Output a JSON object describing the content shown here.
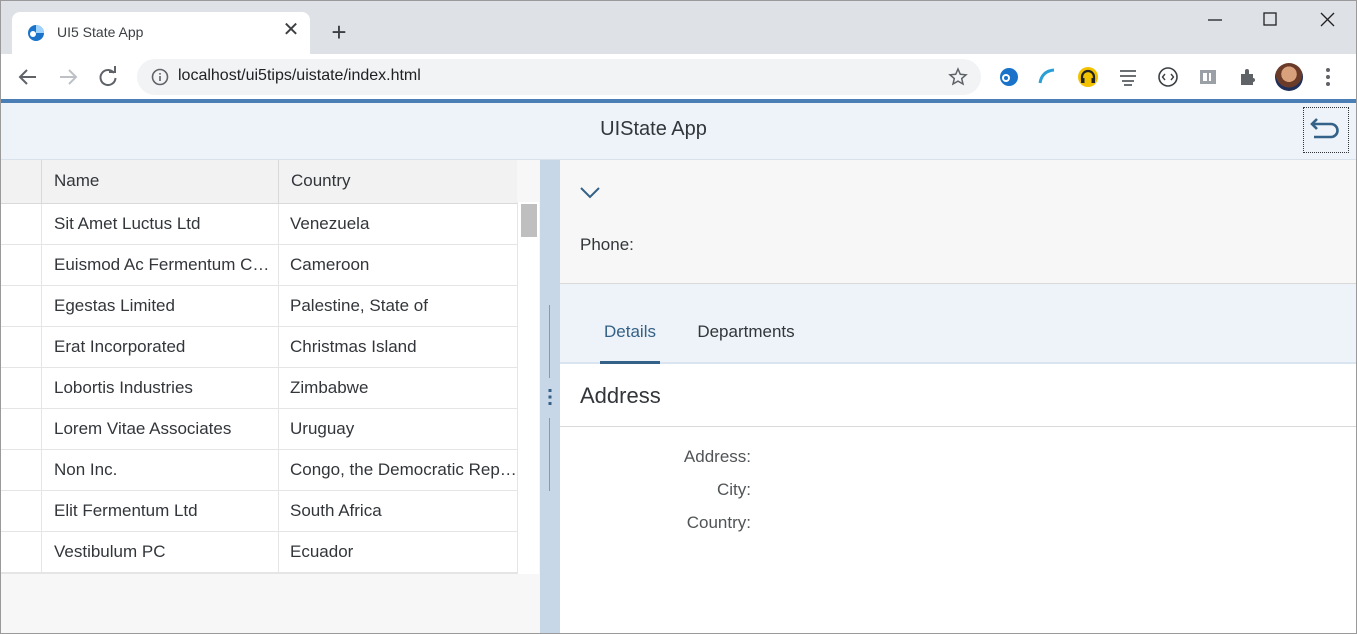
{
  "browser": {
    "tab_title": "UI5 State App",
    "tab_close_glyph": "✕",
    "new_tab_glyph": "+",
    "url_host": "localhost",
    "url_path": "/ui5tips/uistate/index.html",
    "icons": [
      "back-arrow-icon",
      "forward-arrow-icon",
      "reload-icon",
      "info-icon",
      "star-icon",
      "extensions-icon",
      "kebab-menu-icon"
    ]
  },
  "app": {
    "title": "UIState App",
    "accent_color": "#4a7eb5",
    "shell_color": "#edf3f8"
  },
  "table": {
    "columns": [
      "Name",
      "Country"
    ],
    "rows": [
      {
        "name": "Sit Amet Luctus Ltd",
        "country": "Venezuela"
      },
      {
        "name": "Euismod Ac Fermentum Corp.",
        "country": "Cameroon"
      },
      {
        "name": "Egestas Limited",
        "country": "Palestine, State of"
      },
      {
        "name": "Erat Incorporated",
        "country": "Christmas Island"
      },
      {
        "name": "Lobortis Industries",
        "country": "Zimbabwe"
      },
      {
        "name": "Lorem Vitae Associates",
        "country": "Uruguay"
      },
      {
        "name": "Non Inc.",
        "country": "Congo, the Democratic Republic of the"
      },
      {
        "name": "Elit Fermentum Ltd",
        "country": "South Africa"
      },
      {
        "name": "Vestibulum PC",
        "country": "Ecuador"
      }
    ]
  },
  "detail": {
    "phone_label": "Phone:",
    "tabs": [
      "Details",
      "Departments"
    ],
    "section_title": "Address",
    "fields": {
      "address_label": "Address:",
      "city_label": "City:",
      "country_label": "Country:"
    }
  }
}
